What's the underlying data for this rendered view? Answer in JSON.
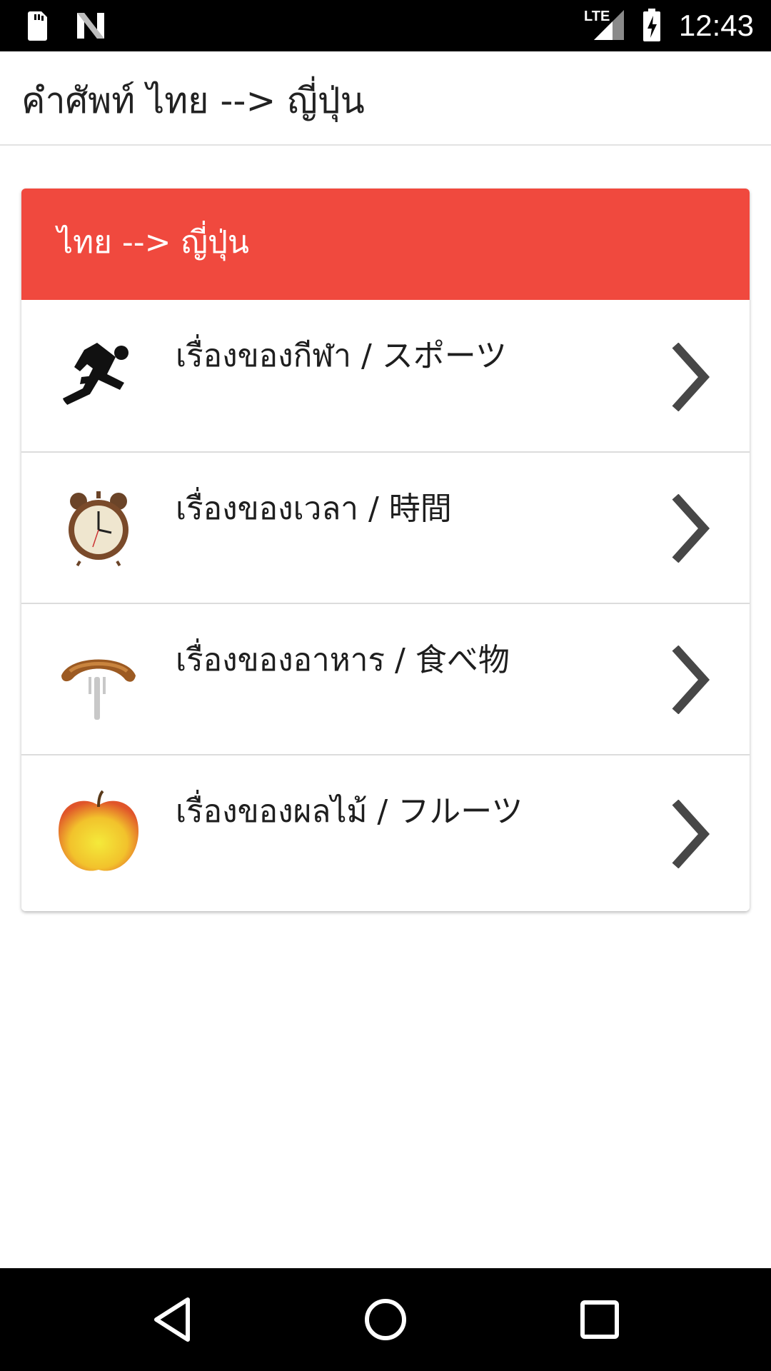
{
  "status_bar": {
    "time": "12:43",
    "network_label": "LTE",
    "icons": [
      "sd-card-icon",
      "n-logo-icon",
      "signal-icon",
      "battery-charging-icon"
    ]
  },
  "app_bar": {
    "title": "คำศัพท์ ไทย --> ญี่ปุ่น"
  },
  "card": {
    "header_title": "ไทย --> ญี่ปุ่น",
    "header_color": "#f0493e",
    "items": [
      {
        "label": "เรื่องของกีฬา / スポーツ",
        "icon": "runner-icon"
      },
      {
        "label": "เรื่องของเวลา / 時間",
        "icon": "alarm-clock-icon"
      },
      {
        "label": "เรื่องของอาหาร / 食べ物",
        "icon": "sausage-fork-icon"
      },
      {
        "label": "เรื่องของผลไม้ / フルーツ",
        "icon": "apple-icon"
      }
    ]
  },
  "nav_bar": {
    "buttons": [
      "back-icon",
      "home-icon",
      "recents-icon"
    ]
  }
}
